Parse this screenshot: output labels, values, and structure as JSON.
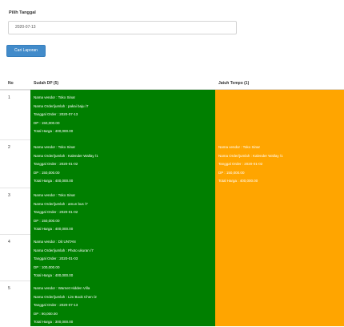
{
  "form": {
    "date_label": "Pilih Tanggal",
    "date_value": "2020-07-13",
    "search_button": "Cari Laporan"
  },
  "table": {
    "headers": [
      "No",
      "Sudah DP (5)",
      "Jatuh Tempo (1)"
    ],
    "rows": [
      {
        "no": "1",
        "dp": [
          "Nama vendor : Toko Sinar",
          "Nama Order/jumlah : pakai baju /7",
          "Tanggal Order : 2020-07-13",
          "DP : 150,000.00",
          "Total Harga : 400,000.00"
        ],
        "jt": []
      },
      {
        "no": "2",
        "dp": [
          "Nama vendor : Toko Sinar",
          "Nama Order/jumlah : Kalender Wallay /1",
          "Tanggal Order : 2020-01-02",
          "DP : 150,000.00",
          "Total Harga : 400,000.00"
        ],
        "jt": [
          "Nama vendor : Toko Sinar",
          "Nama Order/jumlah : Kalender Wallay /1",
          "Tanggal Order : 2020-01-02",
          "DP : 150,000.00",
          "Total Harga : 400,000.00"
        ]
      },
      {
        "no": "3",
        "dp": [
          "Nama vendor : Toko Sinar",
          "Nama Order/jumlah : amun bus /7",
          "Tanggal Order : 2020-01-02",
          "DP : 150,000.00",
          "Total Harga : 400,000.00"
        ],
        "jt": []
      },
      {
        "no": "4",
        "dp": [
          "Nama vendor : Dit UNTAN",
          "Nama Order/jumlah : Photo ukuran /7",
          "Tanggal Order : 2020-01-03",
          "DP : 100,000.00",
          "Total Harga : 400,000.00"
        ],
        "jt": []
      },
      {
        "no": "5",
        "dp": [
          "Nama vendor : Warnet Hidden Villa",
          "Nama Order/jumlah : Lim Book Chen /2",
          "Tanggal Order : 2020-07-13",
          "DP : 90,000.00",
          "Total Harga : 300,000.00"
        ],
        "jt": []
      }
    ]
  },
  "colors": {
    "dp_cell": "#007f00",
    "jatuh_tempo_cell": "#ffa500",
    "button": "#428bca"
  }
}
